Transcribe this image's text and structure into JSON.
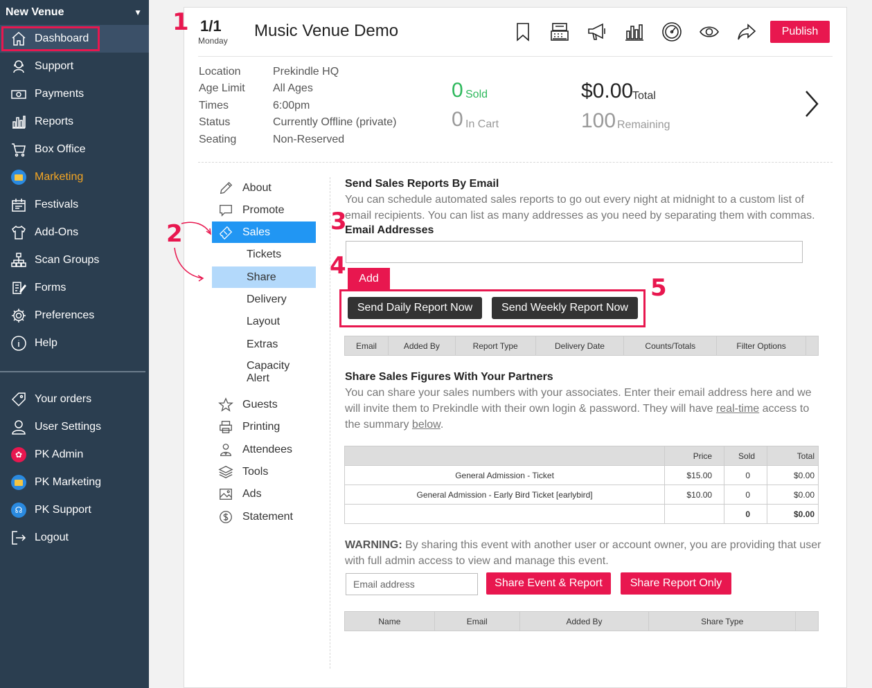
{
  "sidebar": {
    "venue": "New Venue",
    "top_items": [
      {
        "label": "Dashboard",
        "icon": "home-icon"
      },
      {
        "label": "Support",
        "icon": "headset-icon"
      },
      {
        "label": "Payments",
        "icon": "money-icon"
      },
      {
        "label": "Reports",
        "icon": "bar-chart-icon"
      },
      {
        "label": "Box Office",
        "icon": "cart-icon"
      },
      {
        "label": "Marketing",
        "icon": "marketing-icon"
      },
      {
        "label": "Festivals",
        "icon": "festival-icon"
      },
      {
        "label": "Add-Ons",
        "icon": "shirt-icon"
      },
      {
        "label": "Scan Groups",
        "icon": "sitemap-icon"
      },
      {
        "label": "Forms",
        "icon": "form-icon"
      },
      {
        "label": "Preferences",
        "icon": "gear-icon"
      },
      {
        "label": "Help",
        "icon": "info-icon"
      }
    ],
    "bottom_items": [
      {
        "label": "Your orders",
        "icon": "tag-icon"
      },
      {
        "label": "User Settings",
        "icon": "user-icon"
      },
      {
        "label": "PK Admin",
        "icon": "admin-gear-icon"
      },
      {
        "label": "PK Marketing",
        "icon": "marketing-icon"
      },
      {
        "label": "PK Support",
        "icon": "support-icon"
      },
      {
        "label": "Logout",
        "icon": "logout-icon"
      }
    ]
  },
  "markers": [
    "1",
    "2",
    "3",
    "4",
    "5"
  ],
  "header": {
    "date": "1/1",
    "day": "Monday",
    "title": "Music Venue Demo",
    "publish": "Publish"
  },
  "info": {
    "labels": [
      "Location",
      "Age Limit",
      "Times",
      "Status",
      "Seating"
    ],
    "values": [
      "Prekindle HQ",
      "All Ages",
      "6:00pm",
      "Currently Offline (private)",
      "Non-Reserved"
    ]
  },
  "stats": {
    "sold_num": "0",
    "sold_lbl": "Sold",
    "cart_num": "0",
    "cart_lbl": "In Cart",
    "total_num": "$0.00",
    "total_lbl": "Total",
    "remaining_num": "100",
    "remaining_lbl": "Remaining"
  },
  "subnav": {
    "about": "About",
    "promote": "Promote",
    "sales": "Sales",
    "tickets": "Tickets",
    "share": "Share",
    "delivery": "Delivery",
    "layout": "Layout",
    "extras": "Extras",
    "capacity1": "Capacity",
    "capacity2": "Alert",
    "guests": "Guests",
    "printing": "Printing",
    "attendees": "Attendees",
    "tools": "Tools",
    "ads": "Ads",
    "statement": "Statement"
  },
  "reports": {
    "heading": "Send Sales Reports By Email",
    "desc1": "You can schedule automated sales reports to go out every night at midnight to a custom list of",
    "desc2": "email recipients. You can list as many addresses as you need by separating them with commas.",
    "email_label": "Email Addresses",
    "add": "Add",
    "daily": "Send Daily Report Now",
    "weekly": "Send Weekly Report Now",
    "columns": [
      "Email",
      "Added By",
      "Report Type",
      "Delivery Date",
      "Counts/Totals",
      "Filter Options"
    ]
  },
  "share": {
    "heading": "Share Sales Figures With Your Partners",
    "desc1": "You can share your sales numbers with your associates. Enter their email address here and we",
    "desc2a": "will invite them to Prekindle with their own login & password. They will have ",
    "desc2link": "real-time",
    "desc2b": " access to",
    "desc3a": "the summary ",
    "desc3link": "below",
    "desc3b": ".",
    "table_headers": [
      "",
      "Price",
      "Sold",
      "Total"
    ],
    "rows": [
      {
        "name": "General Admission - Ticket",
        "price": "$15.00",
        "sold": "0",
        "total": "$0.00"
      },
      {
        "name": "General Admission - Early Bird Ticket [earlybird]",
        "price": "$10.00",
        "sold": "0",
        "total": "$0.00"
      }
    ],
    "totals": {
      "sold": "0",
      "total": "$0.00"
    },
    "warning_bold": "WARNING:",
    "warning1": " By sharing this event with another user or account owner, you are providing that user",
    "warning2": "with full admin access to view and manage this event.",
    "email_placeholder": "Email address",
    "share_event": "Share Event & Report",
    "share_report": "Share Report Only",
    "partner_columns": [
      "Name",
      "Email",
      "Added By",
      "Share Type"
    ]
  }
}
